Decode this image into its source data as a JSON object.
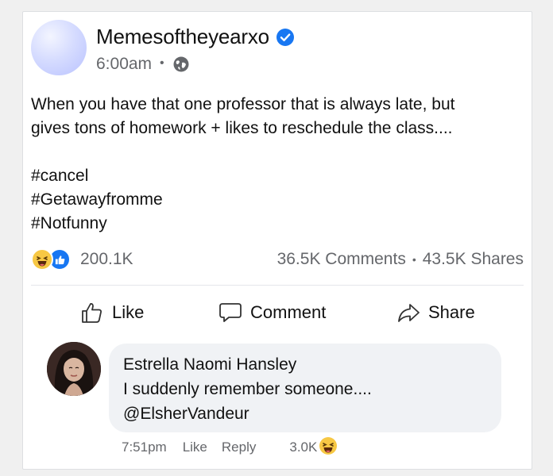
{
  "post": {
    "page_name": "Memesoftheyearxo",
    "time": "6:00am",
    "separator": "•",
    "text_line_1": "When you have that one professor that is always late, but",
    "text_line_2": "gives tons of homework + likes to reschedule the class....",
    "hashtags": [
      "#cancel",
      "#Getawayfromme",
      "#Notfunny"
    ]
  },
  "stats": {
    "reactions": "200.1K",
    "comments": "36.5K Comments",
    "separator": "•",
    "shares": "43.5K Shares"
  },
  "actions": {
    "like": "Like",
    "comment": "Comment",
    "share": "Share"
  },
  "comment": {
    "author": "Estrella Naomi Hansley",
    "text_line_1": "I suddenly remember someone....",
    "text_line_2": "@ElsherVandeur",
    "time": "7:51pm",
    "like": "Like",
    "reply": "Reply",
    "reaction_count": "3.0K"
  },
  "colors": {
    "verified": "#1877f2",
    "like_blue": "#1877f2",
    "haha_yellow": "#f7c844",
    "secondary_text": "#65676b",
    "bubble_bg": "#f0f2f5"
  }
}
